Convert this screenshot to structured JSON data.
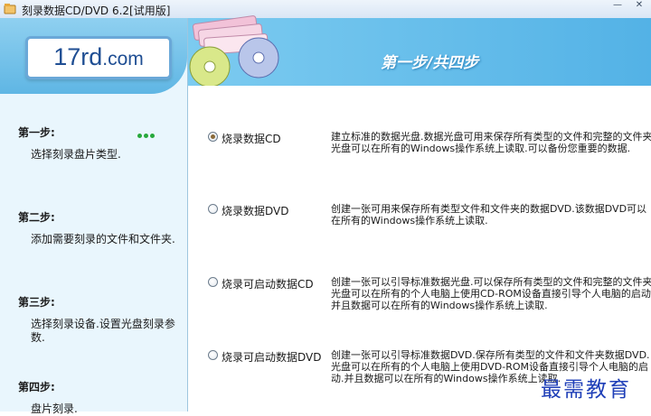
{
  "window": {
    "title": "刻录数据CD/DVD 6.2[试用版]",
    "controls": [
      "minimize-icon",
      "close-icon"
    ]
  },
  "logo": {
    "main": "17rd",
    "suffix": ".com"
  },
  "sidebar": {
    "steps": [
      {
        "title": "第一步:",
        "desc": "选择刻录盘片类型."
      },
      {
        "title": "第二步:",
        "desc": "添加需要刻录的文件和文件夹."
      },
      {
        "title": "第三步:",
        "desc": "选择刻录设备.设置光盘刻录参数."
      },
      {
        "title": "第四步:",
        "desc": "盘片刻录."
      }
    ]
  },
  "banner": {
    "title": "第一步/共四步"
  },
  "options": [
    {
      "label": "烧录数据CD",
      "checked": true,
      "desc": "建立标准的数据光盘.数据光盘可用来保存所有类型的文件和完整的文件夹.光盘可以在所有的Windows操作系统上读取.可以备份您重要的数据."
    },
    {
      "label": "烧录数据DVD",
      "checked": false,
      "desc": "创建一张可用来保存所有类型文件和文件夹的数据DVD.该数据DVD可以在所有的Windows操作系统上读取."
    },
    {
      "label": "烧录可启动数据CD",
      "checked": false,
      "desc": "创建一张可以引导标准数据光盘.可以保存所有类型的文件和完整的文件夹.光盘可以在所有的个人电脑上使用CD-ROM设备直接引导个人电脑的启动.并且数据可以在所有的Windows操作系统上读取."
    },
    {
      "label": "烧录可启动数据DVD",
      "checked": false,
      "desc": "创建一张可以引导标准数据DVD.保存所有类型的文件和文件夹数据DVD.光盘可以在所有的个人电脑上使用DVD-ROM设备直接引导个人电脑的启动.并且数据可以在所有的Windows操作系统上读取."
    }
  ],
  "watermark": "最需教育"
}
